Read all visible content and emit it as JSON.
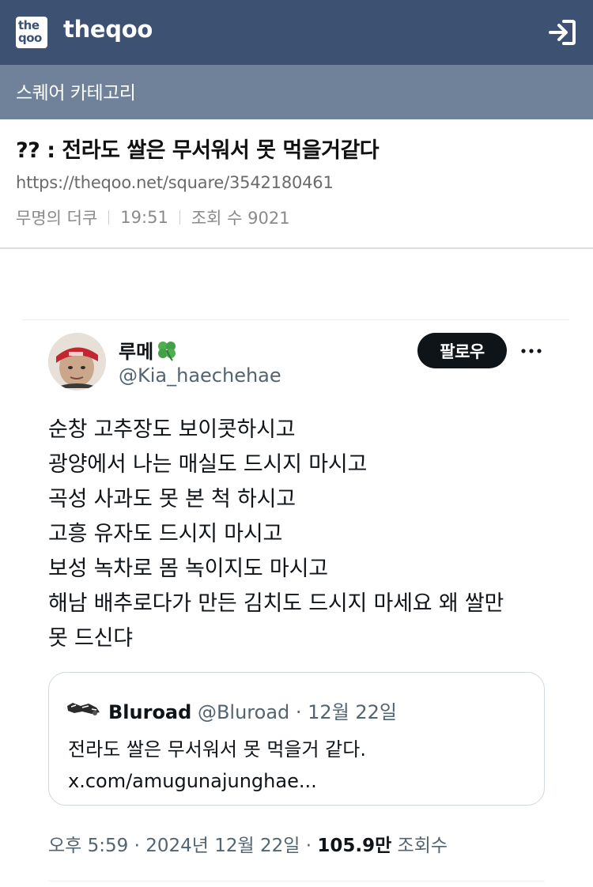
{
  "header": {
    "logo_icon": "theqoo-logo-icon",
    "logo_lines": [
      "the",
      "qoo"
    ],
    "brand": "theqoo",
    "login_icon": "login-arrow-icon"
  },
  "category": {
    "label": "스퀘어 카테고리"
  },
  "post": {
    "title": "?? : 전라도 쌀은 무서워서 못 먹을거같다",
    "url": "https://theqoo.net/square/3542180461",
    "author": "무명의 더쿠",
    "time": "19:51",
    "views": "조회 수 9021"
  },
  "tweet": {
    "display_name": "루메",
    "name_emoji_icon": "four-leaf-clover-icon",
    "handle": "@Kia_haechehae",
    "follow_label": "팔로우",
    "more_icon": "more-dots-icon",
    "lines": [
      "순창 고추장도 보이콧하시고",
      "광양에서 나는 매실도 드시지 마시고",
      "곡성 사과도 못 본 척 하시고",
      "고흥 유자도 드시지 마시고",
      "보성 녹차로 몸 녹이지도 마시고",
      "해남 배추로다가 만든 김치도 드시지 마세요 왜 쌀만",
      "못 드신댜"
    ],
    "quote": {
      "avatar_icon": "bluroad-avatar-icon",
      "name": "Bluroad",
      "handle_date": "@Bluroad · 12월 22일",
      "text": "전라도 쌀은 무서워서 못 먹을거 같다.",
      "link": "x.com/amugunajunghae..."
    },
    "footer": {
      "datetime": "오후 5:59 · 2024년 12월 22일 · ",
      "views_count": "105.9만",
      "views_label": " 조회수"
    }
  },
  "colors": {
    "header_bg": "#3d5272",
    "category_bg": "#6f829a",
    "follow_bg": "#0f1419",
    "muted_text": "#536471"
  }
}
